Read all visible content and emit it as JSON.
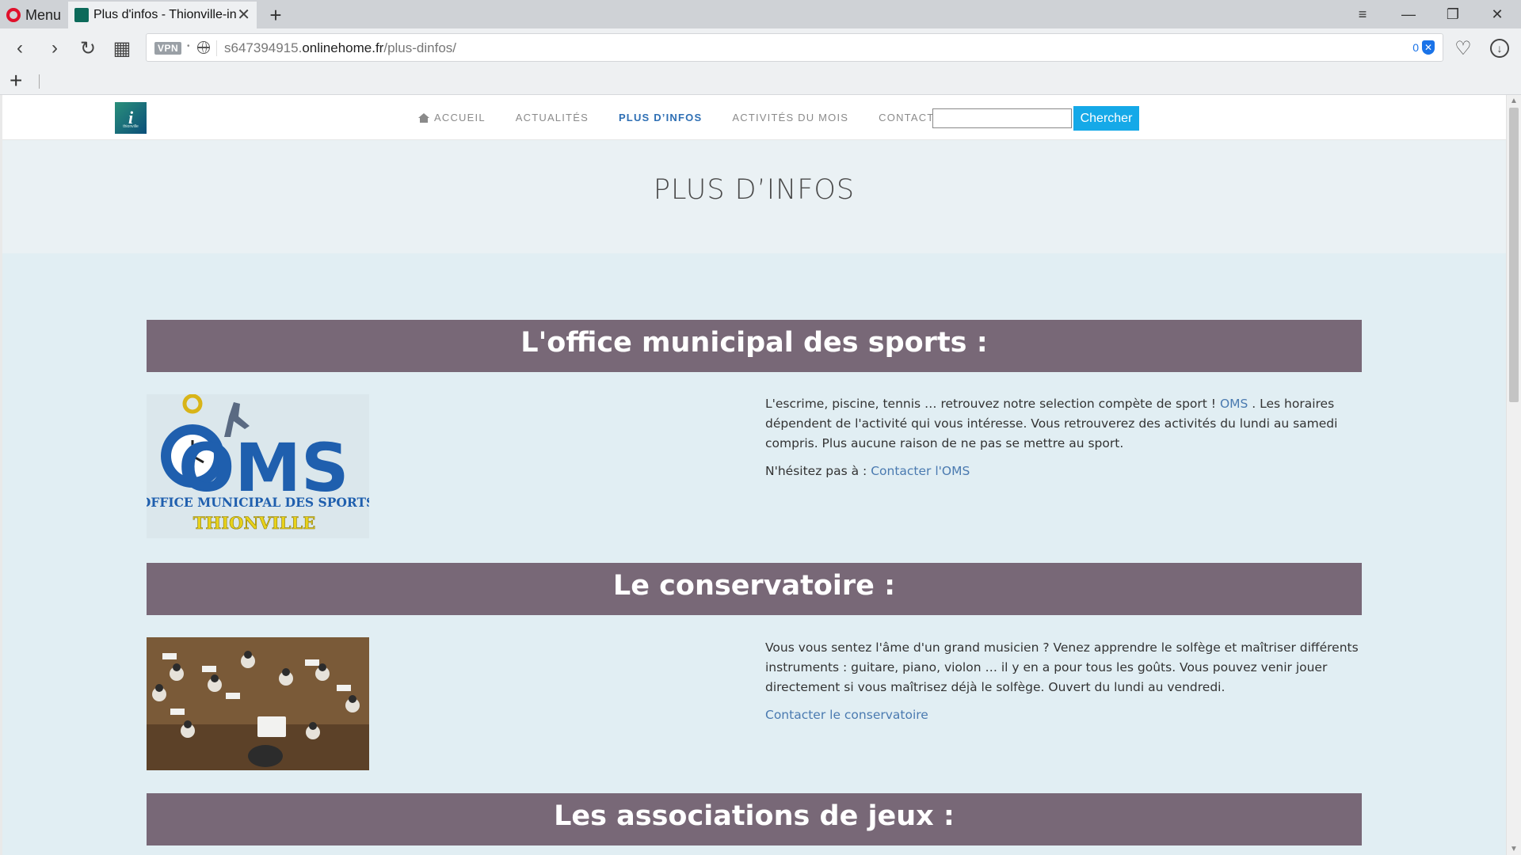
{
  "browser": {
    "menu_label": "Menu",
    "tab": {
      "title": "Plus d'infos - Thionville-infos",
      "close": "✕"
    },
    "new_tab": "+",
    "window": {
      "minimize": "—",
      "restore": "❐",
      "close": "✕",
      "tab_menu": "≡"
    },
    "nav": {
      "back": "‹",
      "forward": "›",
      "reload": "↻",
      "speed_dial": "▦"
    },
    "address": {
      "vpn": "VPN",
      "url_prefix": "s647394915.",
      "url_domain": "onlinehome.fr",
      "url_path": "/plus-dinfos/",
      "adblock_count": "0"
    },
    "heart": "♡",
    "download": "↓",
    "bookmarks_add": "+"
  },
  "site": {
    "logo_text": "i",
    "logo_caption": "thionville",
    "menu": [
      {
        "label": "Accueil",
        "active": false
      },
      {
        "label": "Actualités",
        "active": false
      },
      {
        "label": "Plus d’infos",
        "active": true
      },
      {
        "label": "Activités du mois",
        "active": false
      },
      {
        "label": "Contacts",
        "active": false
      }
    ],
    "search_button": "Chercher",
    "page_title": "PLUS D’INFOS"
  },
  "sections": {
    "oms": {
      "heading": "L'office municipal des sports :",
      "logo_letters": "OMS",
      "logo_line1": "OFFICE MUNICIPAL DES SPORTS",
      "logo_line2": "THIONVILLE",
      "text_before": "L'escrime, piscine, tennis … retrouvez notre selection compète de sport ! ",
      "link_oms": "OMS",
      "text_after": " . Les horaires dépendent de l'activité qui vous intéresse. Vous retrouverez des activités du lundi au samedi compris. Plus aucune raison de ne pas se mettre au sport.",
      "contact_prefix": "N'hésitez pas à : ",
      "contact_link": "Contacter l'OMS"
    },
    "conservatoire": {
      "heading": "Le conservatoire :",
      "text": "Vous vous sentez l'âme d'un grand musicien ? Venez apprendre le solfège et maîtriser différents instruments : guitare, piano, violon … il y en a pour tous les goûts. Vous pouvez venir jouer directement si vous maîtrisez déjà le solfège. Ouvert du lundi au vendredi.",
      "contact_link": "Contacter le conservatoire"
    },
    "jeux": {
      "heading": "Les associations de jeux :"
    }
  },
  "colors": {
    "section_head_bg": "#786877",
    "content_bg": "#e1eef3",
    "accent_button": "#15a9e8",
    "active_menu": "#2e6fb4",
    "link": "#4a7ab0",
    "oms_blue": "#1f5fae",
    "oms_yellow": "#e8d21a"
  }
}
